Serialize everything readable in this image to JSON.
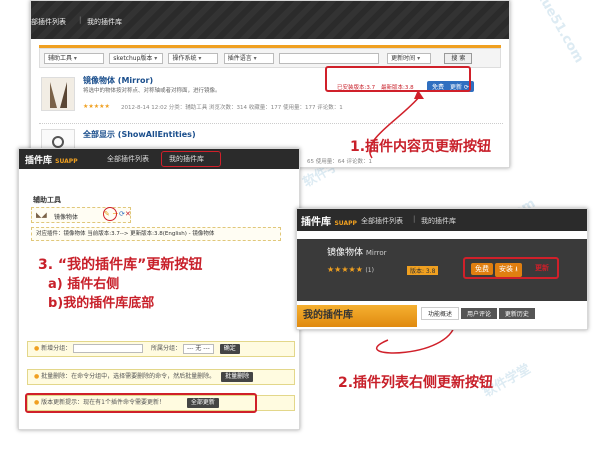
{
  "panel1": {
    "nav": [
      "部插件列表",
      "我的插件库"
    ],
    "filters": [
      "辅助工具",
      "sketchup版本",
      "操作系统",
      "插件语言"
    ],
    "sort": "更新时间",
    "search": "搜 索",
    "item1": {
      "title": "镜像物体 (Mirror)",
      "desc": "将选中的物体按对称点、对称轴或者对称面，进行镜像。",
      "meta": "2012-8-14 12:02  分类：辅助工具  浏览次数：314  收藏量：177  使用量：177  评论数：1",
      "installed": "已安装版本:3.7",
      "latest": "最新版本:3.8",
      "free": "免费",
      "update": "更新"
    },
    "item2": {
      "title": "全部显示 (ShowAllEntities)",
      "meta": "65  使用量：64  评论数：1"
    }
  },
  "panel2": {
    "logo": "插件库",
    "logo_tag": "SUAPP",
    "tabs": [
      "全部插件列表",
      "我的插件库"
    ],
    "section": "辅助工具",
    "item_name": "镜像物体",
    "version_line": "对应插件：镜像物体 当前版本:3.7--> 更新版本:3.8(English) - 镜像物体",
    "new_group": "新增分组：",
    "group_label": "所属分组：",
    "group_value": "--- 无 ---",
    "confirm": "确定",
    "batch": "批量删除：在命令分组中，选择需要删除的命令，然后批量删除。",
    "batch_btn": "批量删除",
    "update_tip": "版本更新提示：现在有1个插件命令需要更新！",
    "update_all": "全部更新"
  },
  "panel3": {
    "logo": "插件库",
    "logo_tag": "SUAPP",
    "tabs": [
      "全部插件列表",
      "我的插件库"
    ],
    "title": "镜像物体",
    "subtitle": "Mirror",
    "rating_count": "(1)",
    "version": "版本: 3.8",
    "free": "免费",
    "install": "安装",
    "update": "更新",
    "mylib": "我的插件库",
    "subtabs": [
      "功能概述",
      "用户评论",
      "更新历史"
    ]
  },
  "callouts": {
    "c1": "1.插件内容页更新按钮",
    "c2": "2.插件列表右侧更新按钮",
    "c3_title": "3. “我的插件库”更新按钮",
    "c3_a": "a) 插件右侧",
    "c3_b": "b)我的插件库底部"
  },
  "colors": {
    "accent_red": "#d0202a",
    "dark_bar": "#2b2b2b",
    "orange": "#f0a020",
    "blue": "#2f6fc0"
  }
}
